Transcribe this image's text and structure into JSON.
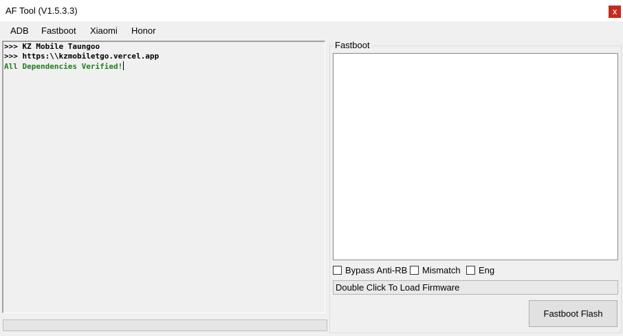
{
  "window": {
    "title": "AF Tool (V1.5.3.3)",
    "close_label": "x"
  },
  "menu": {
    "items": [
      {
        "label": "ADB"
      },
      {
        "label": "Fastboot"
      },
      {
        "label": "Xiaomi"
      },
      {
        "label": "Honor"
      }
    ]
  },
  "console": {
    "lines": [
      ">>> KZ Mobile Taungoo",
      ">>> https:\\\\kzmobiletgo.vercel.app",
      "All Dependencies Verified!"
    ]
  },
  "progress": {
    "value": 0
  },
  "fastboot_panel": {
    "group_label": "Fastboot",
    "options": [
      {
        "label": "Bypass Anti-RB",
        "checked": false
      },
      {
        "label": "Mismatch",
        "checked": false
      },
      {
        "label": "Eng",
        "checked": false
      }
    ],
    "firmware_field": "Double Click To Load Firmware",
    "flash_button": "Fastboot Flash"
  },
  "colors": {
    "console_ok_text": "#1e7d1e",
    "close_button": "#c42b1c"
  }
}
